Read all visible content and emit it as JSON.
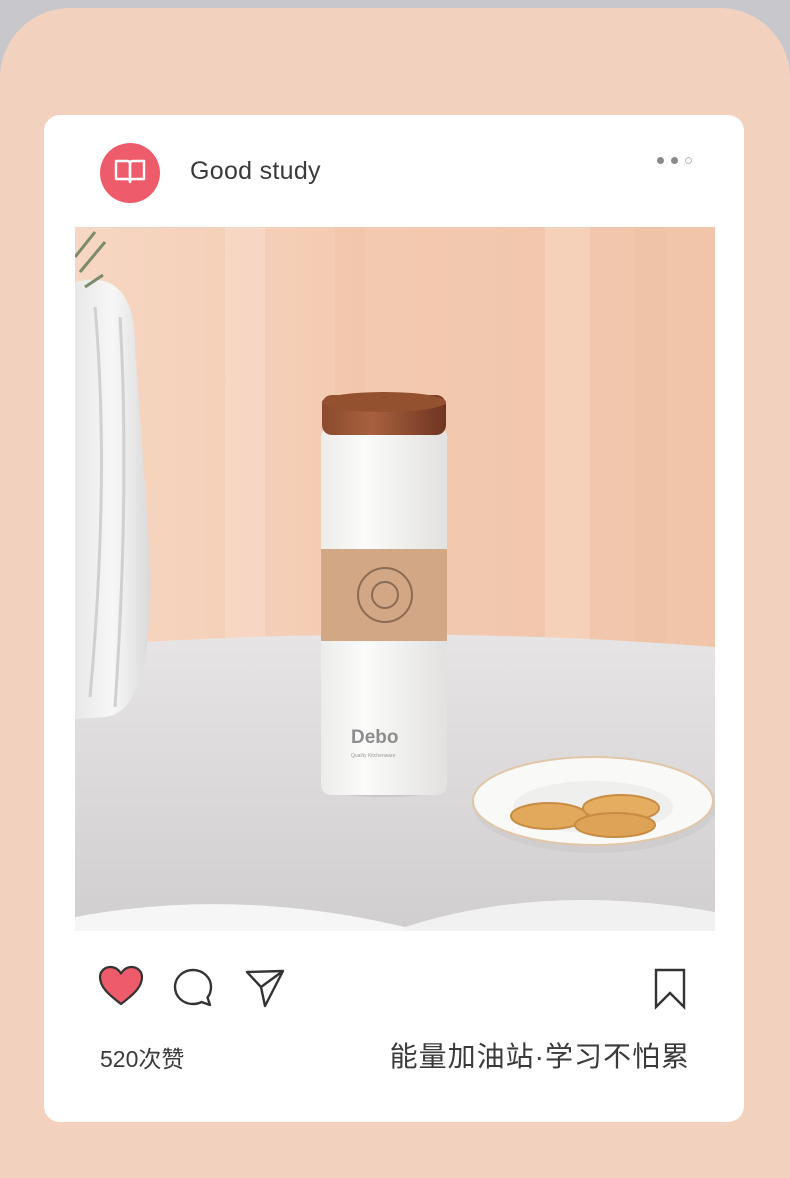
{
  "post": {
    "username": "Good study",
    "avatar_icon": "book-icon",
    "likes_text": "520次赞",
    "caption": "能量加油站·学习不怕累",
    "pagination": {
      "total": 3,
      "active": [
        true,
        true,
        false
      ]
    }
  },
  "product": {
    "brand": "Debo",
    "tagline": "Quality Kitchenware"
  },
  "actions": {
    "like_icon": "heart-icon",
    "comment_icon": "comment-icon",
    "share_icon": "send-icon",
    "save_icon": "bookmark-icon"
  },
  "colors": {
    "background": "#f2d2bf",
    "card": "#ffffff",
    "accent": "#ee5b6b",
    "text": "#3a3a3a"
  }
}
